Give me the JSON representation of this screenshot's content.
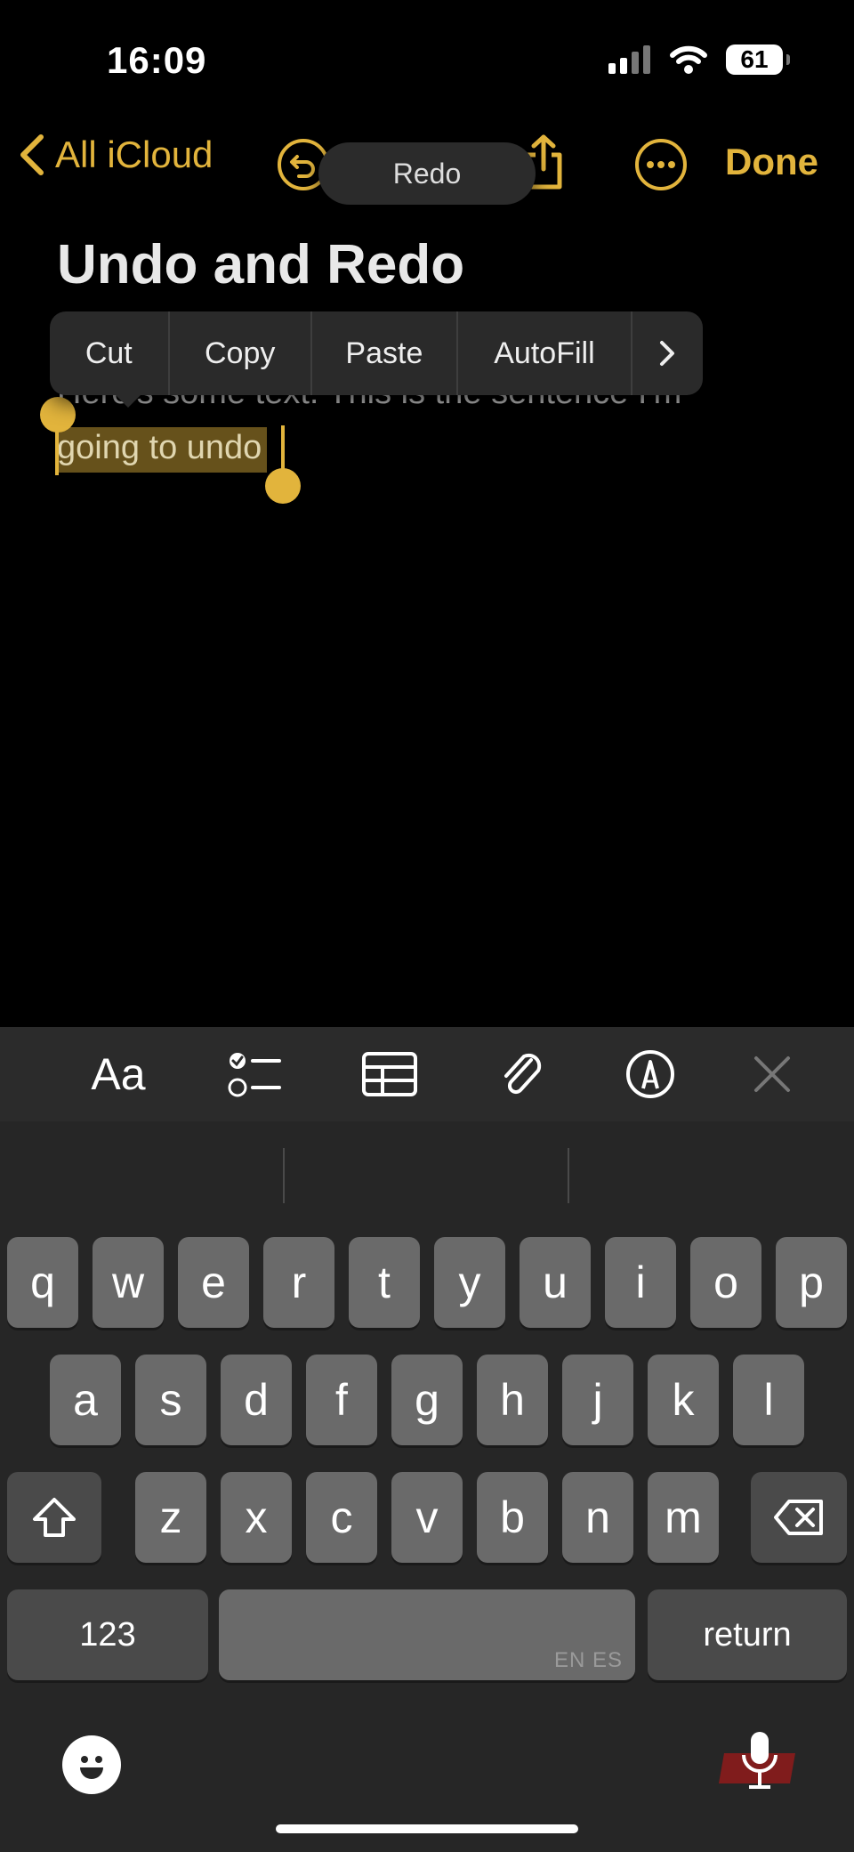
{
  "status_bar": {
    "time": "16:09",
    "battery": "61"
  },
  "nav": {
    "back_label": "All iCloud",
    "done_label": "Done",
    "redo_toast": "Redo"
  },
  "note": {
    "title": "Undo and Redo",
    "line1": "Here's some text. This is the sentence I'm",
    "selected_text": "going to undo"
  },
  "context_menu": {
    "items": [
      "Cut",
      "Copy",
      "Paste",
      "AutoFill"
    ]
  },
  "keyboard": {
    "row1": [
      "q",
      "w",
      "e",
      "r",
      "t",
      "y",
      "u",
      "i",
      "o",
      "p"
    ],
    "row2": [
      "a",
      "s",
      "d",
      "f",
      "g",
      "h",
      "j",
      "k",
      "l"
    ],
    "row3": [
      "z",
      "x",
      "c",
      "v",
      "b",
      "n",
      "m"
    ],
    "numbers_label": "123",
    "space_hint": "EN ES",
    "return_label": "return"
  },
  "colors": {
    "accent": "#e2b43c",
    "background": "#000000",
    "keyboard": "#262626"
  }
}
